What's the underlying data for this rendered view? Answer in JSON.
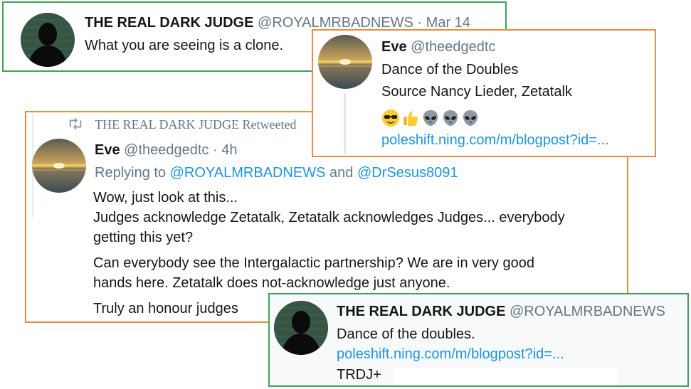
{
  "tweet1": {
    "display_name": "THE REAL DARK JUDGE",
    "handle": "@ROYALMRBADNEWS",
    "separator": "·",
    "time": "Mar 14",
    "text": "What you are seeing is a clone."
  },
  "tweet2": {
    "display_name": "Eve",
    "handle": "@theedgedtc",
    "line1": "Dance of the Doubles",
    "line2": "Source Nancy Lieder, Zetatalk",
    "emojis": [
      "sunglasses-face",
      "thumbs-up",
      "alien",
      "alien",
      "alien"
    ],
    "link": "poleshift.ning.com/m/blogpost?id=..."
  },
  "tweet3": {
    "retweeted_by": "THE REAL DARK JUDGE Retweeted",
    "display_name": "Eve",
    "handle": "@theedgedtc",
    "separator": "·",
    "time": "4h",
    "replying_prefix": "Replying to",
    "reply_user1": "@ROYALMRBADNEWS",
    "reply_and": "and",
    "reply_user2": "@DrSesus8091",
    "p1": "Wow, just look at this...",
    "p2_line1": "Judges acknowledge Zetatalk, Zetatalk acknowledges Judges... everybody",
    "p2_line2": "getting this yet?",
    "p3_line1": "Can everybody see the Intergalactic partnership?  We are in very good",
    "p3_line2": "hands here.  Zetatalk does not-acknowledge just anyone.",
    "p4": "Truly an honour judges"
  },
  "tweet4": {
    "display_name": "THE REAL DARK JUDGE",
    "handle": "@ROYALMRBADNEWS",
    "text": "Dance of the doubles.",
    "link": "poleshift.ning.com/m/blogpost?id=...",
    "signature": "TRDJ+"
  },
  "colors": {
    "green_border": "#3aa557",
    "orange_border": "#f08a3c",
    "link": "#1b95e0",
    "muted": "#657786"
  }
}
